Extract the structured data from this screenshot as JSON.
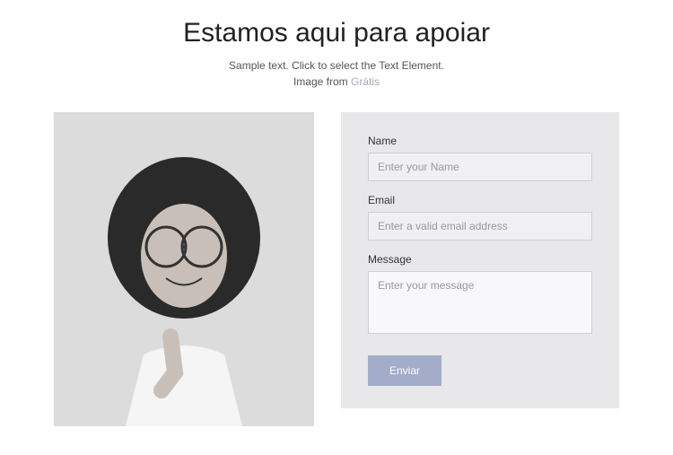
{
  "header": {
    "title": "Estamos aqui para apoiar",
    "subtitle_line1": "Sample text. Click to select the Text Element.",
    "subtitle_line2_prefix": "Image from ",
    "subtitle_link": "Grátis"
  },
  "form": {
    "name": {
      "label": "Name",
      "placeholder": "Enter your Name"
    },
    "email": {
      "label": "Email",
      "placeholder": "Enter a valid email address"
    },
    "message": {
      "label": "Message",
      "placeholder": "Enter your message"
    },
    "submit_label": "Enviar"
  }
}
